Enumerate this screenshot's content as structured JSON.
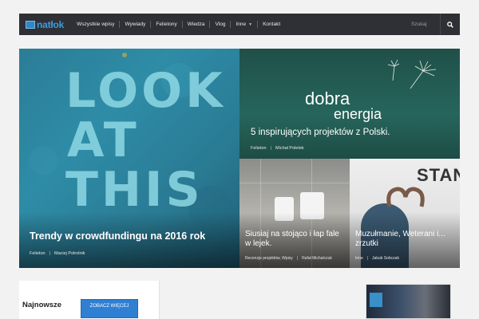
{
  "nav": {
    "logo": "natłok",
    "items": [
      "Wszystkie wpisy",
      "Wywiady",
      "Felietony",
      "Wiedza",
      "Vlog",
      "Inne",
      "Kontakt"
    ],
    "search_placeholder": "Szukaj"
  },
  "hero": {
    "main": {
      "image_text": [
        "LOOK",
        "AT",
        "THIS"
      ],
      "title": "Trendy w crowdfundingu na 2016 rok",
      "category": "Felieton",
      "author": "Maciej Połrolnik"
    },
    "top_right": {
      "image_text_1": "dobra",
      "image_text_2": "energia",
      "title": "5 inspirujących projektów z Polski.",
      "category": "Felieton",
      "author": "Michał Połetek"
    },
    "bottom_left": {
      "title": "Siusiaj na stojąco i łap fale w lejek.",
      "category": "Recenzje projektów, Wpisy",
      "author": "Rafał Michalczuk"
    },
    "bottom_right": {
      "image_text": "STAN",
      "title": "Muzułmanie, Weterani i... zrzutki",
      "category": "Inne",
      "author": "Jakub Sobczak"
    }
  },
  "latest": {
    "title": "Najnowsze",
    "more_button": "ZOBACZ WIĘCEJ"
  },
  "colors": {
    "nav_bg": "#2e3035",
    "accent": "#2f7fd3",
    "page_bg": "#f2f2f2"
  }
}
